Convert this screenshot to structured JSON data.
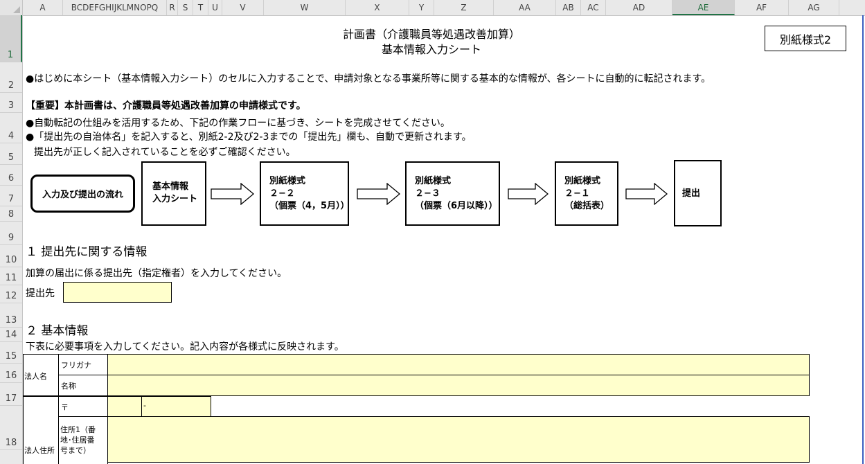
{
  "columns": [
    {
      "label": "A",
      "w": 58,
      "active": false
    },
    {
      "label": "BCDEFGHIJKLMNOPQ",
      "w": 150,
      "active": false
    },
    {
      "label": "R",
      "w": 16,
      "active": false
    },
    {
      "label": "S",
      "w": 22,
      "active": false
    },
    {
      "label": "T",
      "w": 22,
      "active": false
    },
    {
      "label": "U",
      "w": 20,
      "active": false
    },
    {
      "label": "V",
      "w": 60,
      "active": false
    },
    {
      "label": "W",
      "w": 118,
      "active": false
    },
    {
      "label": "X",
      "w": 92,
      "active": false
    },
    {
      "label": "Y",
      "w": 36,
      "active": false
    },
    {
      "label": "Z",
      "w": 86,
      "active": false
    },
    {
      "label": "AA",
      "w": 90,
      "active": false
    },
    {
      "label": "AB",
      "w": 36,
      "active": false
    },
    {
      "label": "AC",
      "w": 36,
      "active": false
    },
    {
      "label": "AD",
      "w": 96,
      "active": false
    },
    {
      "label": "AE",
      "w": 90,
      "active": true
    },
    {
      "label": "AF",
      "w": 78,
      "active": false
    },
    {
      "label": "AG",
      "w": 73,
      "active": false
    }
  ],
  "rows": [
    {
      "label": "1",
      "h": 68,
      "active": true
    },
    {
      "label": "2",
      "h": 44,
      "active": false
    },
    {
      "label": "3",
      "h": 29,
      "active": false
    },
    {
      "label": "4",
      "h": 44,
      "active": false
    },
    {
      "label": "5",
      "h": 31,
      "active": false
    },
    {
      "label": "6",
      "h": 30,
      "active": false
    },
    {
      "label": "7",
      "h": 30,
      "active": false
    },
    {
      "label": "8",
      "h": 22,
      "active": false
    },
    {
      "label": "9",
      "h": 34,
      "active": false
    },
    {
      "label": "10",
      "h": 32,
      "active": false
    },
    {
      "label": "11",
      "h": 26,
      "active": false
    },
    {
      "label": "12",
      "h": 26,
      "active": false
    },
    {
      "label": "13",
      "h": 35,
      "active": false
    },
    {
      "label": "14",
      "h": 21,
      "active": false
    },
    {
      "label": "15",
      "h": 31,
      "active": false
    },
    {
      "label": "16",
      "h": 28,
      "active": false
    },
    {
      "label": "17",
      "h": 33,
      "active": false
    },
    {
      "label": "18",
      "h": 64,
      "active": false
    }
  ],
  "sheet": {
    "title_line1": "計画書（介護職員等処遇改善加算）",
    "title_line2": "基本情報入力シート",
    "form_label": "別紙様式2",
    "intro": "●はじめに本シート（基本情報入力シート）のセルに入力することで、申請対象となる事業所等に関する基本的な情報が、各シートに自動的に転記されます。",
    "important": "【重要】本計画書は、介護職員等処遇改善加算の申請様式です。",
    "note1": "●自動転記の仕組みを活用するため、下記の作業フローに基づき、シートを完成させてください。",
    "note2": "●「提出先の自治体名」を記入すると、別紙2-2及び2-3までの「提出先」欄も、自動で更新されます。",
    "note3": "提出先が正しく記入されていることを必ずご確認ください。",
    "flow": {
      "label": "入力及び提出の流れ",
      "step1_line1": "基本情報",
      "step1_line2": "入力シート",
      "step2_line1": "別紙様式",
      "step2_line2": "２−２",
      "step2_line3": "（個票（4，5月））",
      "step3_line1": "別紙様式",
      "step3_line2": "２−３",
      "step3_line3": "（個票（6月以降））",
      "step4_line1": "別紙様式",
      "step4_line2": "２−１",
      "step4_line3": "（総括表）",
      "step5": "提出"
    },
    "section1_title": "１  提出先に関する情報",
    "section1_desc": "加算の届出に係る提出先（指定権者）を入力してください。",
    "submit_to_label": "提出先",
    "submit_to_value": "",
    "section2_title": "２  基本情報",
    "section2_desc": "下表に必要事項を入力してください。記入内容が各様式に反映されます。",
    "corp_name_label": "法人名",
    "furigana_label": "フリガナ",
    "name_label": "名称",
    "corp_address_label": "法人住所",
    "postal_label": "〒",
    "postal_dash": "-",
    "address1_line1": "住所1（番",
    "address1_line2": "地･住居番",
    "address1_line3": "号まで）",
    "furigana_value": "",
    "name_value": "",
    "postal1_value": "",
    "postal2_value": "",
    "address1_value": ""
  },
  "colors": {
    "input_fill": "#ffffcc",
    "header_bg": "#e9e9e9",
    "active_accent": "#217346"
  }
}
